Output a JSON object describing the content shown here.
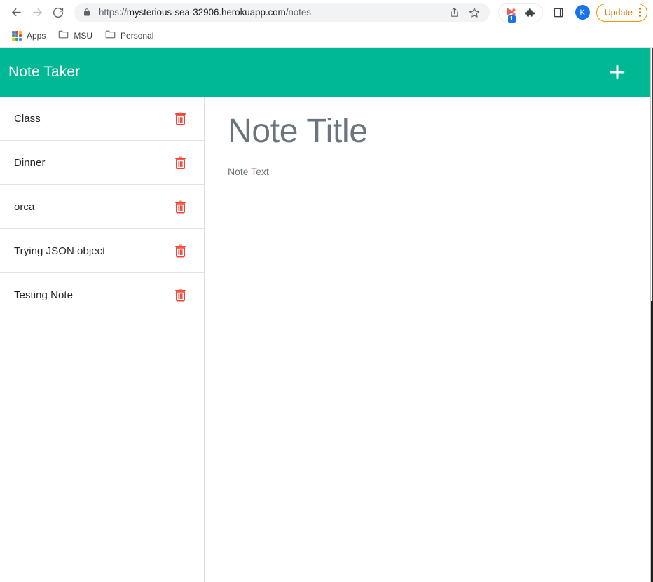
{
  "browser": {
    "nav": {
      "back_icon": "arrow-left-icon",
      "forward_icon": "arrow-right-icon",
      "reload_icon": "reload-icon"
    },
    "omnibox": {
      "lock_icon": "lock-icon",
      "url_scheme": "https://",
      "url_host": "mysterious-sea-32906.herokuapp.com",
      "url_path": "/notes",
      "url_full": "https://mysterious-sea-32906.herokuapp.com/notes",
      "share_icon": "share-icon",
      "bookmark_icon": "star-icon"
    },
    "extensions": {
      "first_icon": "extension-icon",
      "first_badge": "1",
      "puzzle_icon": "puzzle-piece-icon"
    },
    "side_panel_icon": "side-panel-icon",
    "profile": {
      "avatar_icon": "avatar",
      "initial": "K"
    },
    "update": {
      "label": "Update",
      "menu_icon": "three-dot-menu-icon"
    },
    "bookmarks": [
      {
        "label": "Apps",
        "icon": "apps-grid-icon"
      },
      {
        "label": "MSU",
        "icon": "folder-icon"
      },
      {
        "label": "Personal",
        "icon": "folder-icon"
      }
    ]
  },
  "app": {
    "title": "Note Taker",
    "header_color": "#00b894",
    "add_button_icon": "plus-icon",
    "notes": [
      {
        "title": "Class",
        "delete_icon": "trash-icon"
      },
      {
        "title": "Dinner",
        "delete_icon": "trash-icon"
      },
      {
        "title": "orca",
        "delete_icon": "trash-icon"
      },
      {
        "title": "Trying JSON object",
        "delete_icon": "trash-icon"
      },
      {
        "title": "Testing Note",
        "delete_icon": "trash-icon"
      }
    ],
    "editor": {
      "title_value": "",
      "title_placeholder": "Note Title",
      "text_value": "",
      "text_placeholder": "Note Text"
    },
    "colors": {
      "accent": "#00b894",
      "delete": "#f44336",
      "placeholder": "#6c757d"
    }
  }
}
